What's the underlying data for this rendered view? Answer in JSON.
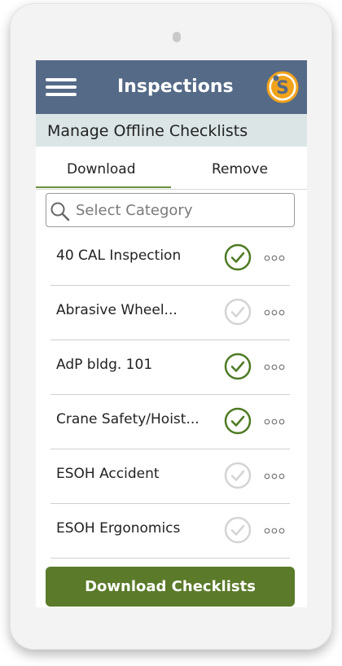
{
  "header": {
    "title": "Inspections",
    "logo_text": "S",
    "menu_icon": "hamburger-menu-icon"
  },
  "subheader": {
    "title": "Manage Offline Checklists"
  },
  "tabs": [
    {
      "label": "Download",
      "active": true
    },
    {
      "label": "Remove",
      "active": false
    }
  ],
  "search": {
    "placeholder": "Select Category",
    "value": "",
    "icon": "search-icon"
  },
  "checklists": [
    {
      "label": "40 CAL Inspection",
      "downloaded": true
    },
    {
      "label": "Abrasive Wheel...",
      "downloaded": false
    },
    {
      "label": "AdP bldg. 101",
      "downloaded": true
    },
    {
      "label": "Crane Safety/Hoist...",
      "downloaded": true
    },
    {
      "label": "ESOH Accident",
      "downloaded": false
    },
    {
      "label": "ESOH Ergonomics",
      "downloaded": false
    }
  ],
  "action_button": {
    "label": "Download Checklists"
  },
  "colors": {
    "header": "#556a87",
    "subheader": "#dbe5e6",
    "accent_green": "#5b7a2a",
    "check_active": "#4e7a23",
    "check_inactive": "#d4d4d4",
    "logo_orange": "#f2a31b"
  }
}
